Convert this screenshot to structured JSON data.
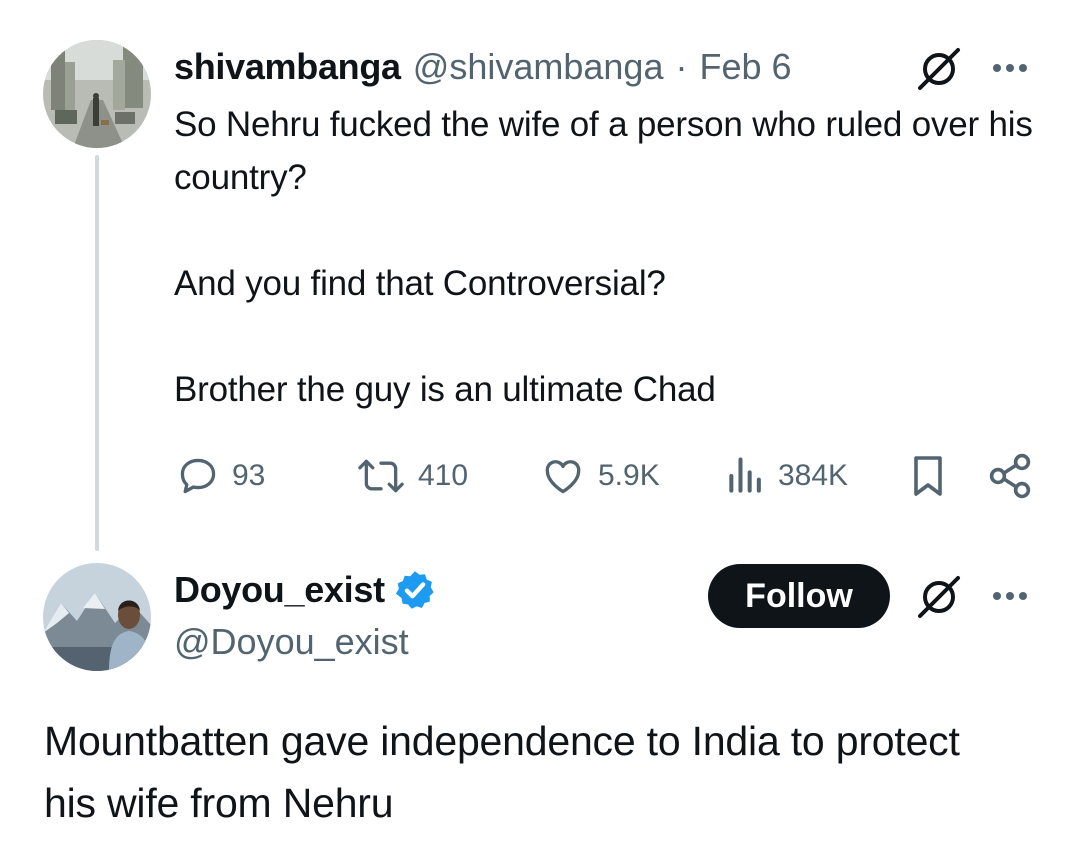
{
  "tweet": {
    "display_name": "shivambanga",
    "handle": "@shivambanga",
    "separator": "·",
    "date": "Feb 6",
    "text": "So Nehru fucked the wife of a person who ruled over his country?\n\nAnd you find that Controversial?\n\nBrother the guy is an ultimate Chad",
    "metrics": {
      "replies": "93",
      "reposts": "410",
      "likes": "5.9K",
      "views": "384K"
    }
  },
  "reply": {
    "display_name": "Doyou_exist",
    "handle": "@Doyou_exist",
    "verified": true,
    "follow_label": "Follow",
    "text": "Mountbatten gave independence to India to protect his wife from Nehru"
  },
  "colors": {
    "text": "#0f1419",
    "muted": "#536471",
    "verified": "#1d9bf0",
    "thread_line": "#cfd9de",
    "button_bg": "#0f1419"
  },
  "icons": [
    "grok-icon",
    "more-icon",
    "reply-icon",
    "repost-icon",
    "like-icon",
    "views-icon",
    "bookmark-icon",
    "share-icon",
    "verified-badge-icon"
  ]
}
